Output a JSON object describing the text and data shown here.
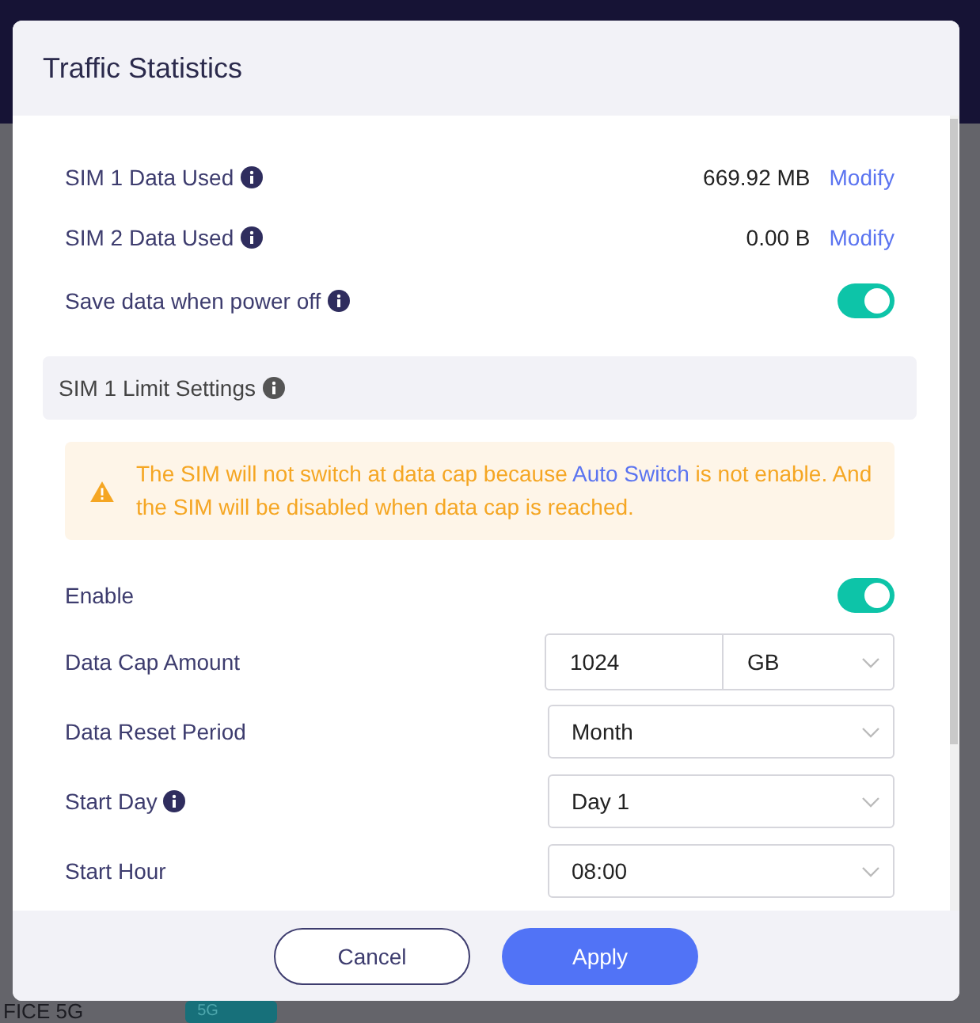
{
  "background": {
    "footer_text": "FICE 5G",
    "badge": "5G"
  },
  "dialog": {
    "title": "Traffic Statistics",
    "usage": [
      {
        "label": "SIM 1 Data Used",
        "info": true,
        "value": "669.92 MB",
        "action": "Modify"
      },
      {
        "label": "SIM 2 Data Used",
        "info": true,
        "value": "0.00 B",
        "action": "Modify"
      }
    ],
    "power_off": {
      "label": "Save data when power off",
      "info": true,
      "on": true
    },
    "section": {
      "title": "SIM 1 Limit Settings",
      "info": true
    },
    "warning": {
      "before": "The SIM will not switch at data cap because ",
      "link": "Auto Switch",
      "after": " is not enable. And the SIM will be disabled when data cap is reached."
    },
    "settings": [
      {
        "kind": "toggle",
        "label": "Enable",
        "info": false,
        "on": true
      },
      {
        "kind": "amount",
        "label": "Data Cap Amount",
        "info": false,
        "value": "1024",
        "unit": "GB"
      },
      {
        "kind": "select",
        "label": "Data Reset Period",
        "info": false,
        "value": "Month"
      },
      {
        "kind": "select",
        "label": "Start Day",
        "info": true,
        "value": "Day 1"
      },
      {
        "kind": "select",
        "label": "Start Hour",
        "info": false,
        "value": "08:00"
      }
    ],
    "buttons": [
      {
        "kind": "secondary",
        "label": "Cancel"
      },
      {
        "kind": "primary",
        "label": "Apply"
      }
    ]
  }
}
